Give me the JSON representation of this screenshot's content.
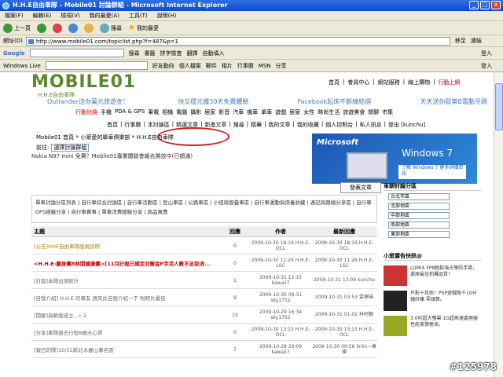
{
  "window": {
    "title": "H.H.E自由車隊 - Mobile01 討論群組 - Microsoft Internet Explorer"
  },
  "menu": [
    "檔案(F)",
    "編輯(E)",
    "檢視(V)",
    "我的最愛(A)",
    "工具(T)",
    "說明(H)"
  ],
  "toolbar": {
    "back": "上一頁",
    "search": "搜尋",
    "favorites": "我的最愛"
  },
  "address": {
    "label": "網址(D)",
    "url": "http://www.mobile01.com/topiclist.php?f=487&p=1",
    "go": "移至",
    "links": "連結"
  },
  "googlebar": {
    "label": "Google",
    "items": [
      "搜尋",
      "書籤",
      "拼字檢查",
      "翻譯",
      "自動填入"
    ],
    "login": "登入"
  },
  "livebar": {
    "label": "Windows Live",
    "items": [
      "好友動向",
      "個人檔案",
      "郵件",
      "相片",
      "行事曆",
      "MSN",
      "分享"
    ],
    "login": "登入"
  },
  "site": {
    "logo": "MOBILE01",
    "subtitle": "H.H.E自由車隊",
    "toplinks": [
      "首頁",
      "會員中心",
      "網站服務",
      "線上購物",
      "行動上網"
    ],
    "promos": [
      "Outlander送你萬元旅遊金！",
      "快又穩光纖30天免費體驗",
      "Facebook起床不斷線結摺",
      "天天送你歐樂B電動牙刷"
    ],
    "cats1": [
      "行動討論",
      "手機",
      "PDA & GPS",
      "筆電",
      "相機",
      "電腦",
      "攝影",
      "居家",
      "影音",
      "汽車",
      "機車",
      "單車",
      "遊戲",
      "居家",
      "女性",
      "時尚生活",
      "旅遊美食",
      "閒聊",
      "市集"
    ],
    "cats2": [
      "首頁",
      "行事曆",
      "本討論區",
      "精選文章",
      "新進文章",
      "搜尋",
      "精華",
      "我的文章",
      "我的收藏",
      "個人控制台",
      "私人訊息",
      "登出 [kunchu]"
    ],
    "breadcrumb": [
      "Mobile01 首頁",
      "小眾愛的單車俱樂部",
      "H.H.E自由車隊"
    ],
    "jump_label": "前往:",
    "jump_select": "選擇討論群組",
    "notice": "Nokia N97 mini 免費？Mobile01專業體驗會報名開放中(已額滿)"
  },
  "ad": {
    "brand": "Microsoft",
    "product": "Windows 7",
    "cta": "了解 Windows 7 更多詳細資訊"
  },
  "actions": {
    "post": "發表文章"
  },
  "forums": "單車討論分區列表 | 自行車綜合討論區 | 自行車活動區 | 登山車區 | 公路車區 | 小徑與摺疊車區 | 自行車運動與保養收藏 | 週記與路線分享區 | 自行車GPS經驗分享 | 自行車賽事 | 單車消費經驗分享 | 商品買賣",
  "table": {
    "headers": [
      "主題",
      "回應",
      "作者",
      "最新回應"
    ],
    "rows": [
      {
        "title": "[公告]HHE自由車隊版規說明",
        "replies": "0",
        "author": "2009-10-30 18:19 H.H.E-OCL",
        "last": "2009-10-30 18:19 H.H.E-OCL",
        "kind": "ann"
      },
      {
        "title": "<H.H.E-慶身團8林閒健康團>[11月行程已確定][聯金P字活人數不足取消...",
        "replies": "0",
        "author": "2009-10-30 11:26 H.H.E-LSC",
        "last": "2009-10-30 11:26 H.H.E-LSC",
        "kind": "hot"
      },
      {
        "title": "[討論]本隊出席統計",
        "replies": "1",
        "author": "2009-10-31 12:15 kawaii7",
        "last": "2009-10-31 13:00 kunchu",
        "kind": "normal"
      },
      {
        "title": "[自我介紹] H.H.E 的車友 請來此自我介紹一下 附照片最佳",
        "replies": "9",
        "author": "2009-10-30 09:31 sky1752",
        "last": "2009-10-31 03:53 雲華喵",
        "kind": "normal"
      },
      {
        "title": "[閒聊]貨軟版成立...» 2",
        "replies": "15",
        "author": "2009-10-29 16:34 sky1752",
        "last": "2009-10-31 01:02 林阿鞭",
        "kind": "normal"
      },
      {
        "title": "[分享]車隊過去行程8規示心得",
        "replies": "0",
        "author": "2009-10-30 13:15 H.H.E-OCL",
        "last": "2009-10-30 13:15 H.H.E-OCL",
        "kind": "normal"
      },
      {
        "title": "[報日的隊]10/31新北木栅山尊名區",
        "replies": "7",
        "author": "2009-10-29 20:09 kawaii7",
        "last": "2009-10-30 00:56 linlin~揀揀",
        "kind": "normal"
      }
    ]
  },
  "sidebar": {
    "title": "車聊討論分區",
    "regions": [
      "台北市區",
      "北部地區",
      "中部地區",
      "南部地區",
      "東部地區"
    ],
    "title2": "小眾廣告快訊@",
    "products": [
      {
        "text": "LUMIX FP8輕鬆強光學防手震，還原最佳拍攝品質！"
      },
      {
        "text": "只對十月底！PSP遊戲限千10分鐘好康 零頭算。"
      },
      {
        "text": "3.0吋超大螢幕 1G超高速處理器 性能美學極深。"
      }
    ]
  },
  "watermark": "#125978",
  "colors": {
    "titlebar": "#0a4ad0",
    "logo_green": "#5a8a2a",
    "highlight_red": "#cc0000",
    "circle_red": "#d61818"
  }
}
